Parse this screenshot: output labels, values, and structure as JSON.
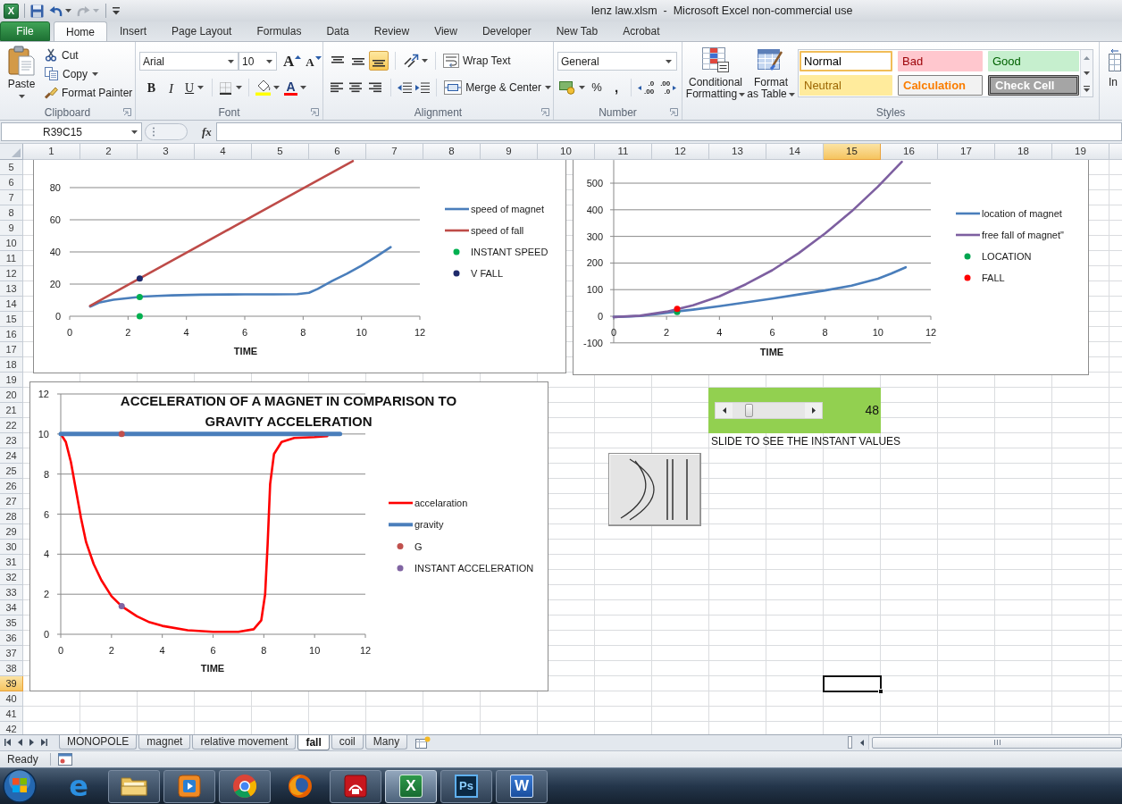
{
  "title_bar": {
    "app_glyph": "X",
    "title": "lenz law.xlsm  -  Microsoft Excel non-commercial use"
  },
  "quick_access": [
    {
      "kind": "save",
      "disabled": false
    },
    {
      "kind": "undo",
      "disabled": false
    },
    {
      "kind": "redo",
      "disabled": true
    },
    {
      "kind": "customize",
      "disabled": false
    }
  ],
  "file_tab": {
    "label": "File"
  },
  "ribbon_tabs": [
    {
      "label": "Home",
      "selected": true
    },
    {
      "label": "Insert",
      "selected": false
    },
    {
      "label": "Page Layout",
      "selected": false
    },
    {
      "label": "Formulas",
      "selected": false
    },
    {
      "label": "Data",
      "selected": false
    },
    {
      "label": "Review",
      "selected": false
    },
    {
      "label": "View",
      "selected": false
    },
    {
      "label": "Developer",
      "selected": false
    },
    {
      "label": "New Tab",
      "selected": false
    },
    {
      "label": "Acrobat",
      "selected": false
    }
  ],
  "clipboard": {
    "label": "Clipboard",
    "paste": "Paste",
    "cut": "Cut",
    "copy": "Copy",
    "format_painter": "Format Painter"
  },
  "font": {
    "label": "Font",
    "font_name": "Arial",
    "font_size": "10",
    "grow_font": "A",
    "shrink_font": "A",
    "bold": "B",
    "italic": "I",
    "underline": "U",
    "font_color": "A"
  },
  "alignment": {
    "label": "Alignment",
    "vertical": [
      {
        "kind": "top",
        "selected": false
      },
      {
        "kind": "middle",
        "selected": false
      },
      {
        "kind": "bottom",
        "selected": true
      }
    ],
    "horizontal": [
      {
        "kind": "left",
        "selected": false
      },
      {
        "kind": "center",
        "selected": false
      },
      {
        "kind": "right",
        "selected": false
      }
    ],
    "wrap_text": "Wrap Text",
    "merge_center": "Merge & Center"
  },
  "number": {
    "label": "Number",
    "format": "General",
    "percent": "%",
    "comma": ",",
    "increase_decimal": [
      ".0",
      ".00"
    ],
    "decrease_decimal": [
      ".00",
      ".0"
    ]
  },
  "styles": {
    "label": "Styles",
    "conditional_formatting": [
      "Conditional",
      "Formatting"
    ],
    "format_as_table": [
      "Format",
      "as Table"
    ],
    "cell_styles": [
      {
        "label": "Normal",
        "kind": "normal",
        "selected": true
      },
      {
        "label": "Bad",
        "kind": "bad",
        "selected": false
      },
      {
        "label": "Good",
        "kind": "good",
        "selected": false
      },
      {
        "label": "Neutral",
        "kind": "neutral",
        "selected": false
      },
      {
        "label": "Calculation",
        "kind": "calculation",
        "selected": false
      },
      {
        "label": "Check Cell",
        "kind": "check",
        "selected": false
      }
    ]
  },
  "cells": {
    "insert": "In"
  },
  "formula_bar": {
    "name_box": "R39C15",
    "fx": "fx"
  },
  "sheet": {
    "column_headers": [
      {
        "label": "1",
        "selected": false
      },
      {
        "label": "2",
        "selected": false
      },
      {
        "label": "3",
        "selected": false
      },
      {
        "label": "4",
        "selected": false
      },
      {
        "label": "5",
        "selected": false
      },
      {
        "label": "6",
        "selected": false
      },
      {
        "label": "7",
        "selected": false
      },
      {
        "label": "8",
        "selected": false
      },
      {
        "label": "9",
        "selected": false
      },
      {
        "label": "10",
        "selected": false
      },
      {
        "label": "11",
        "selected": false
      },
      {
        "label": "12",
        "selected": false
      },
      {
        "label": "13",
        "selected": false
      },
      {
        "label": "14",
        "selected": false
      },
      {
        "label": "15",
        "selected": true
      },
      {
        "label": "16",
        "selected": false
      },
      {
        "label": "17",
        "selected": false
      },
      {
        "label": "18",
        "selected": false
      },
      {
        "label": "19",
        "selected": false
      }
    ],
    "row_headers": [
      {
        "label": "5",
        "selected": false
      },
      {
        "label": "6",
        "selected": false
      },
      {
        "label": "7",
        "selected": false
      },
      {
        "label": "8",
        "selected": false
      },
      {
        "label": "9",
        "selected": false
      },
      {
        "label": "10",
        "selected": false
      },
      {
        "label": "11",
        "selected": false
      },
      {
        "label": "12",
        "selected": false
      },
      {
        "label": "13",
        "selected": false
      },
      {
        "label": "14",
        "selected": false
      },
      {
        "label": "15",
        "selected": false
      },
      {
        "label": "16",
        "selected": false
      },
      {
        "label": "17",
        "selected": false
      },
      {
        "label": "18",
        "selected": false
      },
      {
        "label": "19",
        "selected": false
      },
      {
        "label": "20",
        "selected": false
      },
      {
        "label": "21",
        "selected": false
      },
      {
        "label": "22",
        "selected": false
      },
      {
        "label": "23",
        "selected": false
      },
      {
        "label": "24",
        "selected": false
      },
      {
        "label": "25",
        "selected": false
      },
      {
        "label": "26",
        "selected": false
      },
      {
        "label": "27",
        "selected": false
      },
      {
        "label": "28",
        "selected": false
      },
      {
        "label": "29",
        "selected": false
      },
      {
        "label": "30",
        "selected": false
      },
      {
        "label": "31",
        "selected": false
      },
      {
        "label": "32",
        "selected": false
      },
      {
        "label": "33",
        "selected": false
      },
      {
        "label": "34",
        "selected": false
      },
      {
        "label": "35",
        "selected": false
      },
      {
        "label": "36",
        "selected": false
      },
      {
        "label": "37",
        "selected": false
      },
      {
        "label": "38",
        "selected": false
      },
      {
        "label": "39",
        "selected": true
      },
      {
        "label": "40",
        "selected": false
      },
      {
        "label": "41",
        "selected": false
      },
      {
        "label": "42",
        "selected": false
      }
    ]
  },
  "charts": [
    {
      "chart_data": {
        "type": "line",
        "xlabel": "TIME",
        "xlim": [
          0,
          12
        ],
        "ylim": [
          0,
          97
        ],
        "legend": "right",
        "xticks": [
          0,
          2,
          4,
          6,
          8,
          10,
          12
        ],
        "yticks": [
          0,
          20,
          40,
          60,
          80
        ],
        "series": [
          {
            "name": "speed of magnet",
            "color": "#4a7ebb",
            "x": [
              0.7,
              1,
              1.5,
              2,
              2.5,
              3,
              3.5,
              4.5,
              6,
              7,
              7.8,
              8.2,
              8.5,
              9,
              9.5,
              10,
              10.5,
              11
            ],
            "values": [
              6,
              8.5,
              10.3,
              11.3,
              12.2,
              12.6,
              13,
              13.4,
              13.6,
              13.6,
              13.8,
              14.6,
              17,
              22,
              26.5,
              31.5,
              37,
              43
            ]
          },
          {
            "name": "speed of fall",
            "color": "#be4b48",
            "x": [
              0.7,
              2,
              4,
              6,
              8,
              9.7
            ],
            "values": [
              6.5,
              19.5,
              39.5,
              59.5,
              79.5,
              96.5
            ]
          },
          {
            "name": "INSTANT SPEED",
            "type": "scatter",
            "marker": "circle",
            "color": "#00b050",
            "x": [
              2.4,
              2.4
            ],
            "values": [
              12,
              0
            ]
          },
          {
            "name": "V FALL",
            "type": "scatter",
            "marker": "circle",
            "color": "#1f2a6b",
            "x": [
              2.4
            ],
            "values": [
              23.5
            ]
          }
        ]
      }
    },
    {
      "chart_data": {
        "type": "line",
        "xlabel": "TIME",
        "xlim": [
          0,
          12
        ],
        "ylim": [
          -100,
          587
        ],
        "legend": "right",
        "xticks": [
          0,
          2,
          4,
          6,
          8,
          10,
          12
        ],
        "yticks": [
          -100,
          0,
          100,
          200,
          300,
          400,
          500
        ],
        "series": [
          {
            "name": "location of magnet",
            "color": "#4a7ebb",
            "x": [
              0,
              1,
              2,
              2.4,
              3,
              4,
              5,
              6,
              7,
              8,
              9,
              10,
              10.5,
              11.05
            ],
            "values": [
              -3,
              1,
              13,
              18,
              25,
              38,
              52,
              66,
              82,
              97,
              115,
              141,
              160,
              184
            ]
          },
          {
            "name": "free fall of magnet\"",
            "color": "#7d5fa0",
            "x": [
              0,
              1,
              2,
              3,
              4,
              5,
              6,
              7,
              8,
              9,
              10,
              10.9
            ],
            "values": [
              -3,
              2,
              17,
              41,
              75,
              120,
              173,
              237,
              311,
              394,
              487,
              580
            ]
          },
          {
            "name": "LOCATION",
            "type": "scatter",
            "marker": "circle",
            "color": "#00a550",
            "x": [
              2.4
            ],
            "values": [
              16
            ]
          },
          {
            "name": "FALL",
            "type": "scatter",
            "marker": "circle",
            "color": "#ff0000",
            "x": [
              2.4
            ],
            "values": [
              28
            ]
          }
        ]
      }
    },
    {
      "chart_data": {
        "type": "line",
        "title": "ACCELERATION OF A MAGNET IN COMPARISON TO GRAVITY ACCELERATION",
        "xlabel": "TIME",
        "xlim": [
          0,
          12
        ],
        "ylim": [
          0,
          12
        ],
        "legend": "right",
        "xticks": [
          0,
          2,
          4,
          6,
          8,
          10,
          12
        ],
        "yticks": [
          0,
          2,
          4,
          6,
          8,
          10,
          12
        ],
        "series": [
          {
            "name": "accelaration",
            "color": "#ff0000",
            "x": [
              0,
              0.2,
              0.4,
              0.6,
              0.8,
              1,
              1.3,
              1.6,
              2,
              2.4,
              3,
              3.5,
              4,
              5,
              6,
              7,
              7.6,
              7.9,
              8.05,
              8.15,
              8.25,
              8.4,
              8.7,
              9.2,
              10,
              10.5
            ],
            "values": [
              10,
              9.6,
              8.6,
              7.2,
              5.8,
              4.6,
              3.5,
              2.7,
              1.9,
              1.4,
              0.9,
              0.6,
              0.42,
              0.2,
              0.12,
              0.12,
              0.25,
              0.7,
              2,
              4.5,
              7.5,
              9,
              9.6,
              9.8,
              9.85,
              9.9
            ]
          },
          {
            "name": "gravity",
            "color": "#4a7ebb",
            "x": [
              0,
              11
            ],
            "values": [
              10,
              10
            ]
          },
          {
            "name": "G",
            "type": "scatter",
            "marker": "circle",
            "color": "#c0504d",
            "x": [
              2.4
            ],
            "values": [
              10
            ]
          },
          {
            "name": "INSTANT ACCELERATION",
            "type": "scatter",
            "marker": "circle",
            "color": "#8064a2",
            "x": [
              2.4
            ],
            "values": [
              1.4
            ]
          }
        ]
      }
    }
  ],
  "scroll_control": {
    "level": 0.2,
    "value": "48",
    "caption": "SLIDE TO SEE THE INSTANT VALUES"
  },
  "sheet_tabs": [
    {
      "label": "MONOPOLE",
      "selected": false
    },
    {
      "label": "magnet",
      "selected": false
    },
    {
      "label": "relative movement",
      "selected": false
    },
    {
      "label": "fall",
      "selected": true
    },
    {
      "label": "coil",
      "selected": false
    },
    {
      "label": "Many",
      "selected": false
    }
  ],
  "status_bar": {
    "text": "Ready"
  },
  "taskbar": [
    {
      "kind": "start",
      "running": false,
      "selected": false
    },
    {
      "kind": "e_browser",
      "glyph": "e",
      "running": false,
      "selected": false
    },
    {
      "kind": "folder",
      "running": true,
      "selected": false
    },
    {
      "kind": "media",
      "running": true,
      "selected": false
    },
    {
      "kind": "ball_browser",
      "running": true,
      "selected": false
    },
    {
      "kind": "fox_browser",
      "running": false,
      "selected": false
    },
    {
      "kind": "pdf_tool",
      "running": true,
      "selected": false
    },
    {
      "kind": "spreadsheet",
      "glyph": "X",
      "running": true,
      "selected": true
    },
    {
      "kind": "image_editor",
      "glyph": "Ps",
      "running": true,
      "selected": false
    },
    {
      "kind": "word_processor",
      "glyph": "W",
      "running": true,
      "selected": false
    }
  ]
}
